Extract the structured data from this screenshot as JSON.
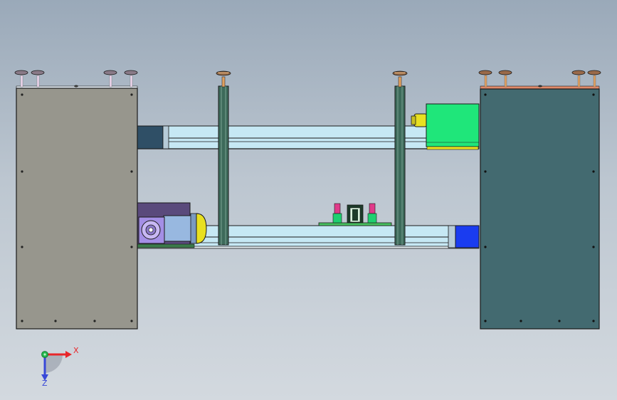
{
  "colors": {
    "background_top": "#9aa9b9",
    "background_bottom": "#d3d9df",
    "left_panel": "#97968d",
    "right_panel": "#436a70",
    "rail": "#c6e8f4",
    "post": "#3d6a5a",
    "green_motor": "#1fe67a",
    "blue_block": "#1a3cf0",
    "yellow_flange": "#e8e020",
    "purple_gearbox": "#a48fe6",
    "axis_x": "#e8262a",
    "axis_y": "#23b54a",
    "axis_z": "#3848d8"
  },
  "axis_triad": {
    "x_label": "X",
    "z_label": "Z"
  }
}
